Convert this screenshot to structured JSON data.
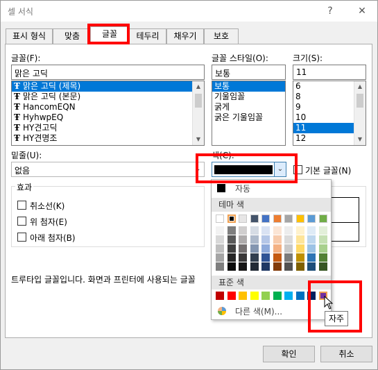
{
  "window": {
    "title": "셀 서식",
    "help_label": "?",
    "close_label": "✕"
  },
  "tabs": [
    {
      "label": "표시 형식"
    },
    {
      "label": "맞춤"
    },
    {
      "label": "글꼴"
    },
    {
      "label": "테두리"
    },
    {
      "label": "채우기"
    },
    {
      "label": "보호"
    }
  ],
  "font": {
    "label": "글꼴(F):",
    "value": "맑은 고딕",
    "items": [
      "맑은 고딕 (제목)",
      "맑은 고딕 (본문)",
      "HancomEQN",
      "HyhwpEQ",
      "HY견고딕",
      "HY견명조"
    ],
    "icon_glyph": "Ŧ"
  },
  "style": {
    "label": "글꼴 스타일(O):",
    "value": "보통",
    "items": [
      "보통",
      "기울임꼴",
      "굵게",
      "굵은 기울임꼴"
    ]
  },
  "size": {
    "label": "크기(S):",
    "value": "11",
    "items": [
      "6",
      "8",
      "9",
      "10",
      "11",
      "12"
    ]
  },
  "underline": {
    "label": "밑줄(U):",
    "value": "없음"
  },
  "color": {
    "label": "색(C):",
    "normal_font_label": "기본 글꼴(N)"
  },
  "effects": {
    "label": "효과",
    "strikethrough": "취소선(K)",
    "superscript": "위 첨자(E)",
    "subscript": "아래 첨자(B)"
  },
  "info_text": "트루타입 글꼴입니다. 화면과 프린터에 사용되는 글꼴",
  "buttons": {
    "ok": "확인",
    "cancel": "취소"
  },
  "palette": {
    "automatic_label": "자동",
    "theme_label": "테마 색",
    "standard_label": "표준 색",
    "more_label": "다른 색(M)...",
    "theme_rows": [
      [
        "#ffffff",
        "#000000",
        "#e7e6e6",
        "#44546a",
        "#4472c4",
        "#ed7d31",
        "#a5a5a5",
        "#ffc000",
        "#5b9bd5",
        "#70ad47"
      ],
      [
        "#f2f2f2",
        "#7f7f7f",
        "#d0cece",
        "#d6dce4",
        "#d9e2f3",
        "#fbe5d5",
        "#ededed",
        "#fff2cc",
        "#deebf6",
        "#e2efd9"
      ],
      [
        "#d8d8d8",
        "#595959",
        "#aeabab",
        "#adb9ca",
        "#b4c6e7",
        "#f7cbac",
        "#dbdbdb",
        "#fee599",
        "#bdd7ee",
        "#c5e0b3"
      ],
      [
        "#bfbfbf",
        "#3f3f3f",
        "#757070",
        "#8496b0",
        "#8eaadb",
        "#f4b183",
        "#c9c9c9",
        "#ffd965",
        "#9cc3e5",
        "#a8d08d"
      ],
      [
        "#a5a5a5",
        "#262626",
        "#3a3838",
        "#323f4f",
        "#2f5496",
        "#c55a11",
        "#7b7b7b",
        "#bf9000",
        "#2e75b5",
        "#538135"
      ],
      [
        "#7f7f7f",
        "#0c0c0c",
        "#171616",
        "#222a35",
        "#1f3864",
        "#833c0b",
        "#525252",
        "#7f6000",
        "#1e4e79",
        "#375623"
      ]
    ],
    "standard_colors": [
      "#c00000",
      "#ff0000",
      "#ffc000",
      "#ffff00",
      "#92d050",
      "#00b050",
      "#00b0f0",
      "#0070c0",
      "#002060",
      "#7030a0"
    ],
    "selected_color": "#000000",
    "tooltip": "자주"
  }
}
